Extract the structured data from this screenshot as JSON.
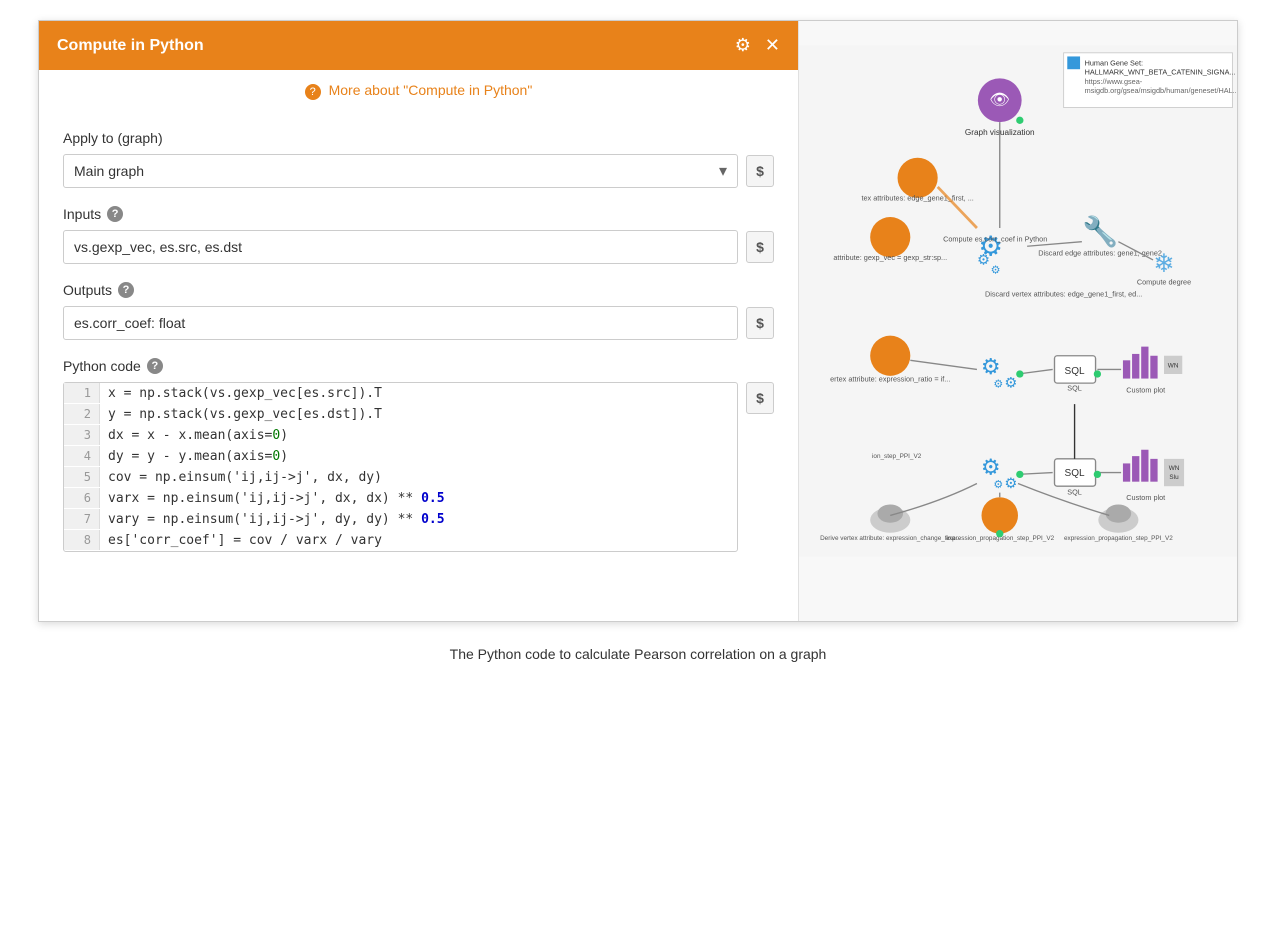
{
  "window": {
    "title": "Compute in Python",
    "help_link": "More about \"Compute in Python\"",
    "gear_icon": "⚙",
    "close_icon": "✕"
  },
  "form": {
    "apply_label": "Apply to (graph)",
    "graph_value": "Main graph",
    "graph_options": [
      "Main graph"
    ],
    "inputs_label": "Inputs",
    "inputs_info": "?",
    "inputs_value": "vs.gexp_vec, es.src, es.dst",
    "outputs_label": "Outputs",
    "outputs_info": "?",
    "outputs_value": "es.corr_coef: float",
    "code_label": "Python code",
    "code_info": "?"
  },
  "code_lines": [
    {
      "num": "1",
      "code": "x = np.stack(vs.gexp_vec[es.src]).T"
    },
    {
      "num": "2",
      "code": "y = np.stack(vs.gexp_vec[es.dst]).T"
    },
    {
      "num": "3",
      "code": "dx = x - x.mean(axis=0)"
    },
    {
      "num": "4",
      "code": "dy = y - y.mean(axis=0)"
    },
    {
      "num": "5",
      "code": "cov = np.einsum('ij,ij->j', dx, dy)"
    },
    {
      "num": "6",
      "code": "varx = np.einsum('ij,ij->j', dx, dx) ** 0.5"
    },
    {
      "num": "7",
      "code": "vary = np.einsum('ij,ij->j', dy, dy) ** 0.5"
    },
    {
      "num": "8",
      "code": "es['corr_coef'] = cov / varx / vary"
    }
  ],
  "graph": {
    "info_box_color": "#3498DB",
    "info_text": "Human Gene Set: HALLMARK_WNT_BETA_CATENIN_SIGNAL\nhttps://www.gsea-msigdb.org/gsea/msigdb/human/geneset/HAL..."
  },
  "caption": "The Python code to calculate Pearson correlation on a graph",
  "dollar_symbol": "$"
}
